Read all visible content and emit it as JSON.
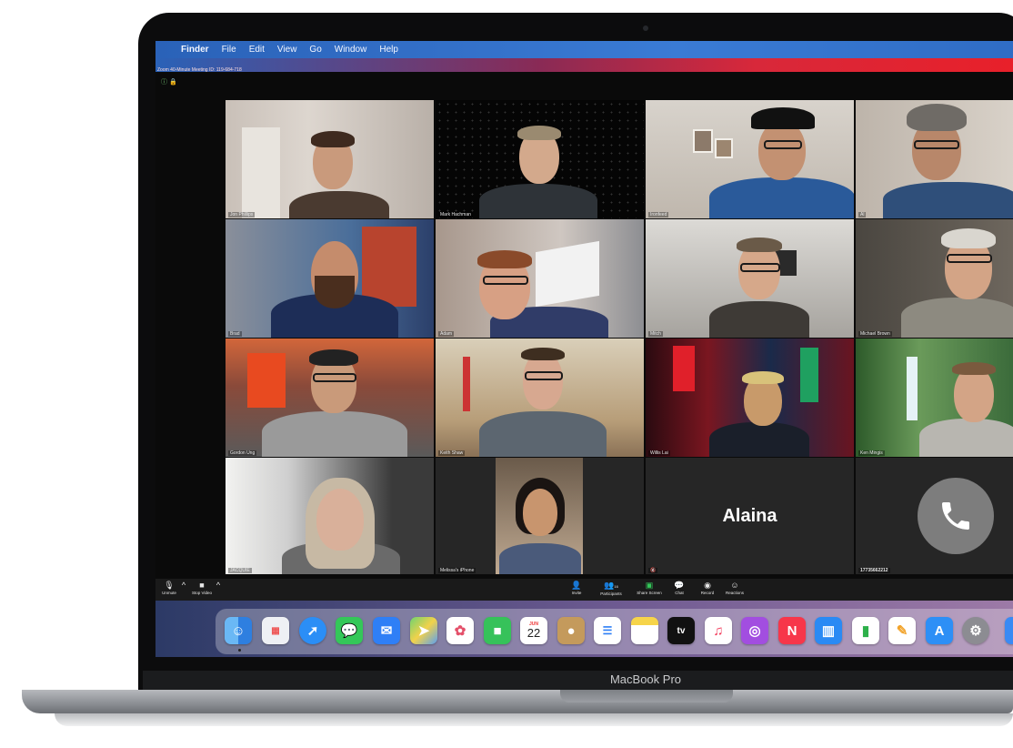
{
  "device_label": "MacBook Pro",
  "menubar": {
    "apple": "",
    "items": [
      "Finder",
      "File",
      "Edit",
      "View",
      "Go",
      "Window",
      "Help"
    ]
  },
  "zoom": {
    "window_title": "Zoom 40-Minute Meeting ID: 119-684-718"
  },
  "tiles": [
    {
      "label": "Jon Phillips"
    },
    {
      "label": "Mark Hachman"
    },
    {
      "label": "Ironfeed"
    },
    {
      "label": "Al"
    },
    {
      "label": "Brad"
    },
    {
      "label": "Adam"
    },
    {
      "label": "Mitch"
    },
    {
      "label": "Michael Brown"
    },
    {
      "label": "Gordon Ung"
    },
    {
      "label": "Keith Shaw"
    },
    {
      "label": "Willis Lai"
    },
    {
      "label": "Ken Mingis"
    },
    {
      "label": "JACQUIE"
    },
    {
      "label": "Melissa's iPhone"
    },
    {
      "label": "",
      "name": "Alaina"
    },
    {
      "label": "17735662212"
    }
  ],
  "toolbar": {
    "unmute": "Unmute",
    "stop_video": "Stop Video",
    "invite": "Invite",
    "participants": "Participants",
    "participants_count": "16",
    "share_screen": "Share Screen",
    "chat": "Chat",
    "record": "Record",
    "reactions": "Reactions"
  },
  "dock": {
    "calendar_month": "JUN",
    "calendar_day": "22",
    "apps": [
      "Finder",
      "Launchpad",
      "Safari",
      "Messages",
      "Mail",
      "Maps",
      "Photos",
      "FaceTime",
      "Calendar",
      "Contacts",
      "Reminders",
      "Notes",
      "TV",
      "Music",
      "Podcasts",
      "News",
      "Keynote",
      "Numbers",
      "Pages",
      "App Store",
      "System Preferences"
    ]
  }
}
